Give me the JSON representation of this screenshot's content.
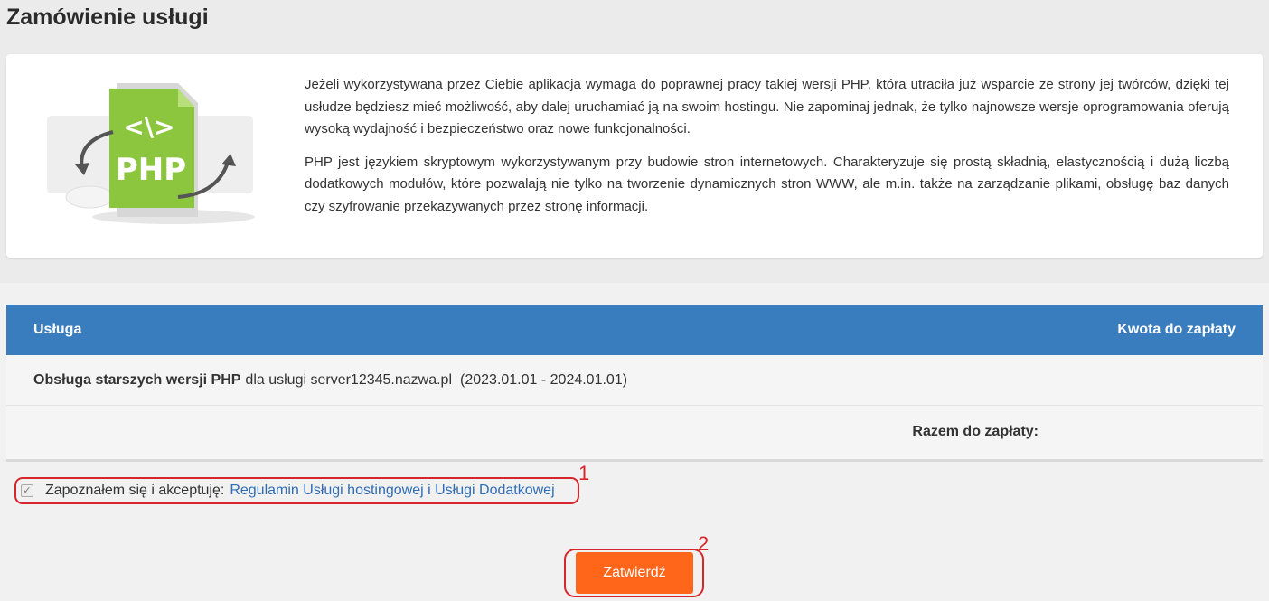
{
  "page": {
    "title": "Zamówienie usługi"
  },
  "info": {
    "paragraph_1": "Jeżeli wykorzystywana przez Ciebie aplikacja wymaga do poprawnej pracy takiej wersji PHP, która utraciła już wsparcie ze strony jej twórców, dzięki tej usłudze będziesz mieć możliwość, aby dalej uruchamiać ją na swoim hostingu. Nie zapominaj jednak, że tylko najnowsze wersje oprogramowania oferują wysoką wydajność i bezpieczeństwo oraz nowe funkcjonalności.",
    "paragraph_2": "PHP jest językiem skryptowym wykorzystywanym przy budowie stron internetowych. Charakteryzuje się prostą składnią, elastycznością i dużą liczbą dodatkowych modułów, które pozwalają nie tylko na tworzenie dynamicznych stron WWW, ale m.in. także na zarządzanie plikami, obsługę baz danych czy szyfrowanie przekazywanych przez stronę informacji.",
    "illustration": {
      "icon": "php-file-icon",
      "code_symbol": "<\\>",
      "label": "PHP"
    }
  },
  "table": {
    "col_service": "Usługa",
    "col_amount": "Kwota do zapłaty",
    "rows": [
      {
        "service_name": "Obsługa starszych wersji PHP",
        "service_for": "dla usługi server12345.nazwa.pl",
        "period": "(2023.01.01 - 2024.01.01)"
      }
    ],
    "total_label": "Razem do zapłaty:"
  },
  "terms": {
    "checked": true,
    "label": "Zapoznałem się i akceptuję:",
    "link_text": "Regulamin Usługi hostingowej i Usługi Dodatkowej"
  },
  "annotations": {
    "marker_1": "1",
    "marker_2": "2",
    "color": "#d6252b"
  },
  "actions": {
    "submit_label": "Zatwierdź"
  },
  "colors": {
    "header_blue": "#3a7dbf",
    "submit_orange": "#ff6619",
    "link_blue": "#2f6db5",
    "php_green": "#8cc63f"
  }
}
